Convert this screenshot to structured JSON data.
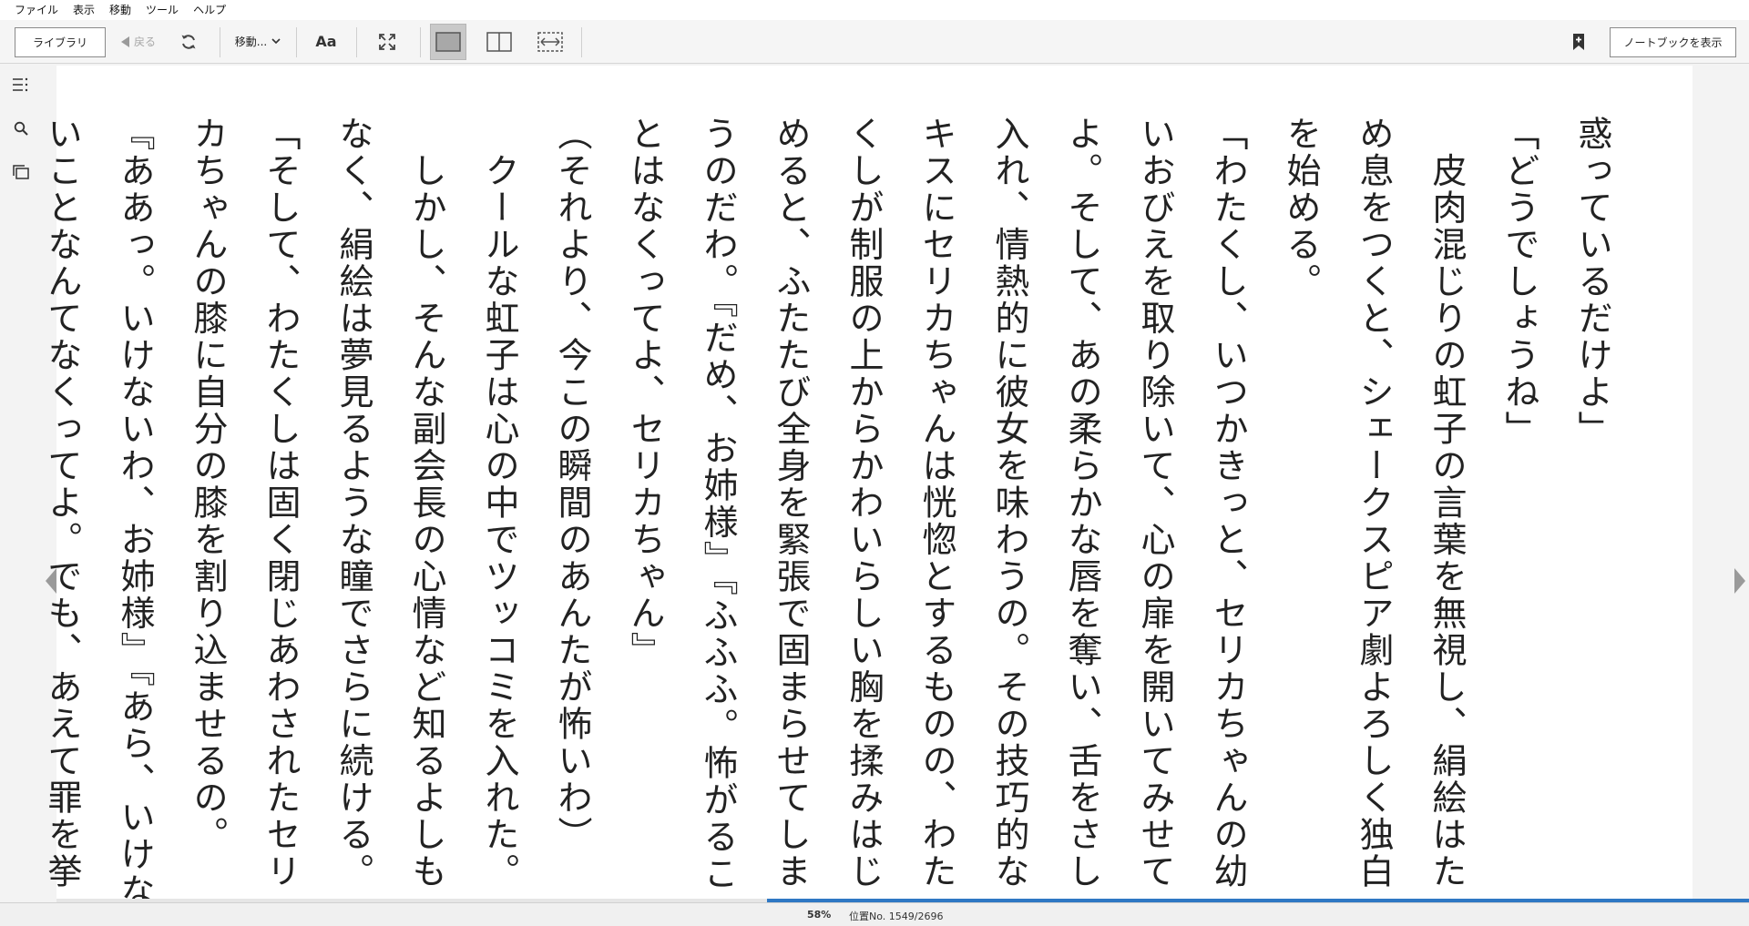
{
  "menu": [
    "ファイル",
    "表示",
    "移動",
    "ツール",
    "ヘルプ"
  ],
  "toolbar": {
    "library_label": "ライブラリ",
    "back_label": "戻る",
    "goto_label": "移動...",
    "font_label": "Aa",
    "notebook_label": "ノートブックを表示"
  },
  "left_rail": {
    "icons": [
      "table-of-contents-icon",
      "search-icon",
      "flashcards-icon"
    ]
  },
  "book": {
    "columns": [
      "惑っているだけよ」",
      "「どうでしょうね」",
      "　皮肉混じりの虹子の言葉を無視し、絹絵はた",
      "め息をつくと、シェークスピア劇よろしく独白",
      "を始める。",
      "「わたくし、いつかきっと、セリカちゃんの幼",
      "いおびえを取り除いて、心の扉を開いてみせて",
      "よ。そして、あの柔らかな唇を奪い、舌をさし",
      "入れ、情熱的に彼女を味わうの。その技巧的な",
      "キスにセリカちゃんは恍惚とするものの、わた",
      "くしが制服の上からかわいらしい胸を揉みはじ",
      "めると、ふたたび全身を緊張で固まらせてしま",
      "うのだわ。『だめ、お姉様』『ふふふ。怖がるこ",
      "とはなくってよ、セリカちゃん』",
      "（それより、今この瞬間のあんたが怖いわ）",
      "　クールな虹子は心の中でツッコミを入れた。",
      "　しかし、そんな副会長の心情など知るよしも",
      "なく、絹絵は夢見るような瞳でさらに続ける。",
      "「そして、わたくしは固く閉じあわされたセリ",
      "カちゃんの膝に自分の膝を割り込ませるの。",
      "『ああっ。いけないわ、お姉様』『あら、いけな",
      "いことなんてなくってよ。でも、あえて罪を挙"
    ]
  },
  "status": {
    "progress_fraction": 0.58,
    "percent_label": "58%",
    "position_label": "位置No. 1549/2696"
  },
  "colors": {
    "progress": "#2f78c4",
    "page": "#ffffff",
    "chrome": "#f0f0f0"
  }
}
